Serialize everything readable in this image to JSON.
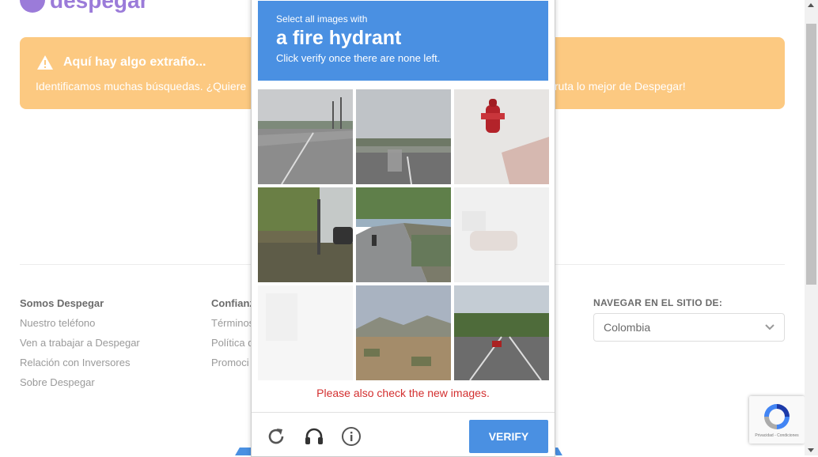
{
  "header": {
    "logo_text": "despegar",
    "brand_color": "#9b7bd9"
  },
  "alert": {
    "title": "Aquí hay algo extraño...",
    "text_left": "Identificamos muchas búsquedas. ¿Quiere",
    "text_right": "fruta lo mejor de Despegar!",
    "bg_color": "#fcc981"
  },
  "footer": {
    "col1": {
      "title": "Somos Despegar",
      "links": [
        "Nuestro teléfono",
        "Ven a trabajar a Despegar",
        "Relación con Inversores",
        "Sobre Despegar"
      ]
    },
    "col2": {
      "title": "Confianz",
      "links": [
        "Términos",
        "Política d",
        "Promoci"
      ]
    },
    "nav_title": "NAVEGAR EN EL SITIO DE:",
    "country": "Colombia"
  },
  "captcha": {
    "line1": "Select all images with",
    "target": "a fire hydrant",
    "line3": "Click verify once there are none left.",
    "message": "Please also check the new images.",
    "verify_label": "VERIFY",
    "accent": "#4a90e2",
    "error_color": "#d32f2f",
    "icons": [
      "reload-icon",
      "headphones-icon",
      "info-icon"
    ]
  },
  "recaptcha_badge": {
    "text": "Privacidad - Condiciones"
  }
}
